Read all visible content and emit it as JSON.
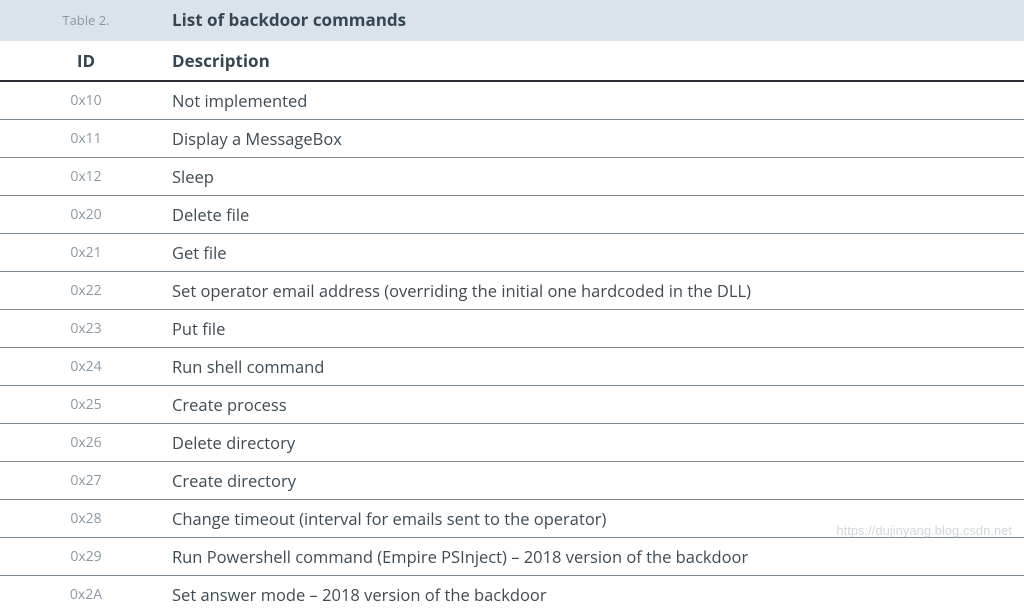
{
  "table": {
    "number": "Table 2.",
    "title": "List of backdoor commands",
    "columns": {
      "id": "ID",
      "desc": "Description"
    },
    "rows": [
      {
        "id": "0x10",
        "desc": "Not implemented"
      },
      {
        "id": "0x11",
        "desc": "Display a MessageBox"
      },
      {
        "id": "0x12",
        "desc": "Sleep"
      },
      {
        "id": "0x20",
        "desc": "Delete file"
      },
      {
        "id": "0x21",
        "desc": "Get file"
      },
      {
        "id": "0x22",
        "desc": "Set operator email address (overriding the initial one hardcoded in the DLL)"
      },
      {
        "id": "0x23",
        "desc": "Put file"
      },
      {
        "id": "0x24",
        "desc": "Run shell command"
      },
      {
        "id": "0x25",
        "desc": "Create process"
      },
      {
        "id": "0x26",
        "desc": "Delete directory"
      },
      {
        "id": "0x27",
        "desc": "Create directory"
      },
      {
        "id": "0x28",
        "desc": "Change timeout (interval for emails sent to the operator)"
      },
      {
        "id": "0x29",
        "desc": "Run Powershell command (Empire PSInject) – 2018 version of the backdoor"
      },
      {
        "id": "0x2A",
        "desc": "Set answer mode – 2018 version of the backdoor"
      }
    ]
  },
  "watermark": "https://dujinyang.blog.csdn.net"
}
